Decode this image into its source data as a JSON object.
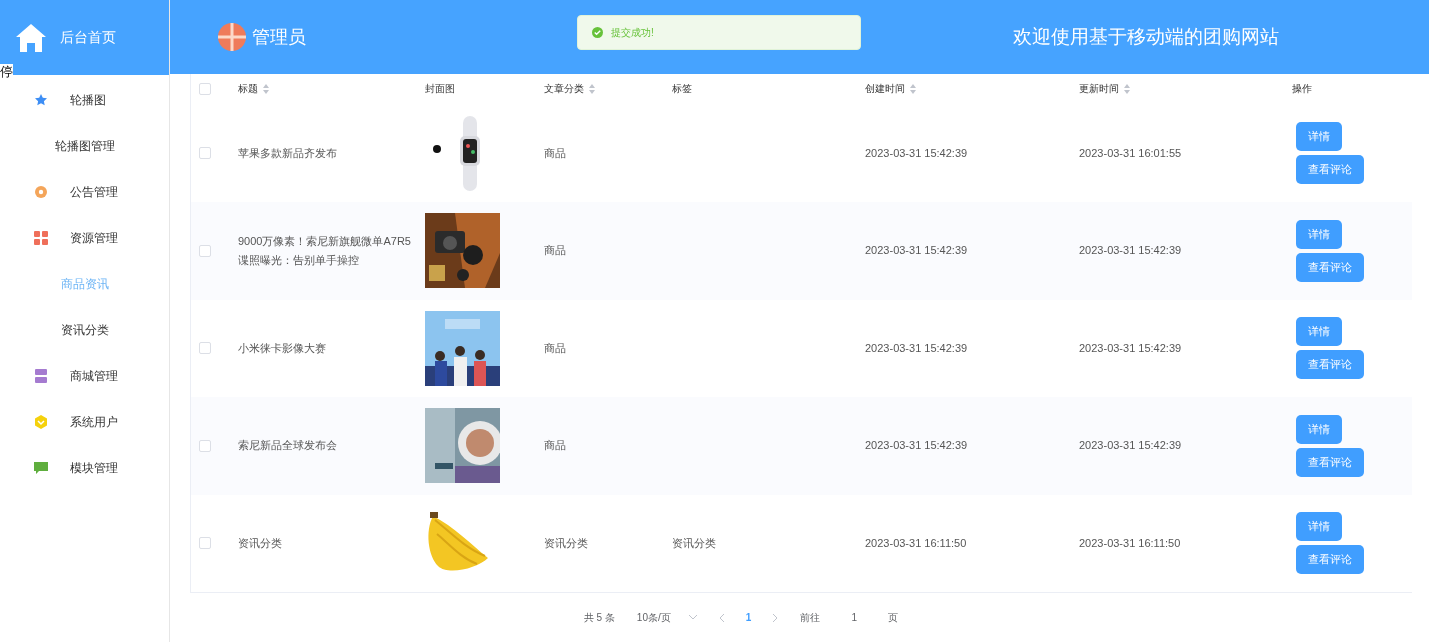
{
  "sidebar": {
    "home": {
      "label": "后台首页"
    },
    "overlay_text": "停",
    "menus": [
      {
        "label": "轮播图",
        "children": [
          {
            "label": "轮播图管理",
            "selected": false
          }
        ]
      },
      {
        "label": "公告管理"
      },
      {
        "label": "资源管理",
        "children": [
          {
            "label": "商品资讯",
            "selected": true
          },
          {
            "label": "资讯分类",
            "selected": false
          }
        ]
      },
      {
        "label": "商城管理"
      },
      {
        "label": "系统用户"
      },
      {
        "label": "模块管理"
      }
    ]
  },
  "header": {
    "user": "管理员",
    "site_title": "欢迎使用基于移动端的团购网站"
  },
  "toast": {
    "message": "提交成功!",
    "kind": "success"
  },
  "table": {
    "select_all_checked": false,
    "columns": [
      {
        "label": "标题",
        "sortable": true
      },
      {
        "label": "封面图",
        "sortable": false
      },
      {
        "label": "文章分类",
        "sortable": true
      },
      {
        "label": "标签",
        "sortable": false
      },
      {
        "label": "创建时间",
        "sortable": true
      },
      {
        "label": "更新时间",
        "sortable": true
      },
      {
        "label": "操作",
        "sortable": false
      }
    ],
    "rows": [
      {
        "checked": false,
        "title": "苹果多款新品齐发布",
        "category": "商品",
        "created": "2023-03-31 15:42:39",
        "updated": "2023-03-31 16:01:55",
        "actions": [
          "详情",
          "查看评论"
        ]
      },
      {
        "checked": false,
        "title": "9000万像素！索尼新旗舰微单A7R5谍照曝光：告别单手操控",
        "category": "商品",
        "created": "2023-03-31 15:42:39",
        "updated": "2023-03-31 15:42:39",
        "actions": [
          "详情",
          "查看评论"
        ]
      },
      {
        "checked": false,
        "title": "小米徕卡影像大赛",
        "category": "商品",
        "created": "2023-03-31 15:42:39",
        "updated": "2023-03-31 15:42:39",
        "actions": [
          "详情",
          "查看评论"
        ]
      },
      {
        "checked": false,
        "title": "索尼新品全球发布会",
        "category": "商品",
        "created": "2023-03-31 15:42:39",
        "updated": "2023-03-31 15:42:39",
        "actions": [
          "详情",
          "查看评论"
        ]
      },
      {
        "checked": false,
        "title": "资讯分类",
        "category": "资讯分类",
        "tag": "资讯分类",
        "created": "2023-03-31 16:11:50",
        "updated": "2023-03-31 16:11:50",
        "actions": [
          "详情",
          "查看评论"
        ]
      }
    ]
  },
  "pagination": {
    "total": "共 5 条",
    "page_size": "10条/页",
    "pages": [
      {
        "label": "1",
        "selected": true
      }
    ],
    "goto_label": "前往",
    "goto_value": "1",
    "goto_suffix": "页"
  }
}
